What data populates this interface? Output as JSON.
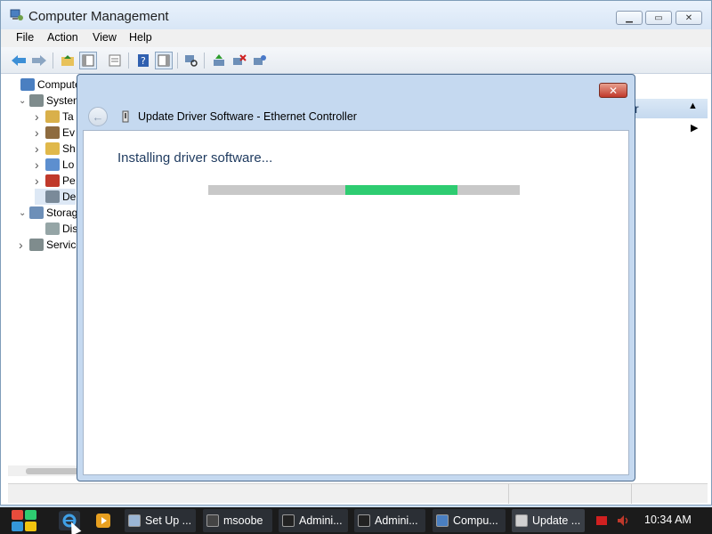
{
  "window": {
    "title": "Computer Management",
    "icon": "computer-management-icon"
  },
  "menu": [
    "File",
    "Action",
    "View",
    "Help"
  ],
  "tree": {
    "items": [
      {
        "label": "Computer",
        "indent": 0,
        "expander": "",
        "icon": "computer-icon"
      },
      {
        "label": "System",
        "indent": 1,
        "expander": "expanded",
        "icon": "tools-icon"
      },
      {
        "label": "Ta",
        "indent": 2,
        "expander": "collapsed",
        "icon": "clock-icon"
      },
      {
        "label": "Ev",
        "indent": 2,
        "expander": "collapsed",
        "icon": "event-viewer-icon"
      },
      {
        "label": "Sh",
        "indent": 2,
        "expander": "collapsed",
        "icon": "shared-folder-icon"
      },
      {
        "label": "Lo",
        "indent": 2,
        "expander": "collapsed",
        "icon": "users-icon"
      },
      {
        "label": "Pe",
        "indent": 2,
        "expander": "collapsed",
        "icon": "performance-icon"
      },
      {
        "label": "De",
        "indent": 2,
        "expander": "",
        "icon": "device-manager-icon"
      },
      {
        "label": "Storag",
        "indent": 1,
        "expander": "expanded",
        "icon": "storage-icon"
      },
      {
        "label": "Dis",
        "indent": 2,
        "expander": "",
        "icon": "disk-icon"
      },
      {
        "label": "Service",
        "indent": 1,
        "expander": "collapsed",
        "icon": "services-icon"
      }
    ]
  },
  "actions_pane": {
    "header_text": "r"
  },
  "dialog": {
    "title": "Update Driver Software - Ethernet Controller",
    "status_text": "Installing driver software...",
    "progress": {
      "start_fraction": 0.44,
      "end_fraction": 0.8
    },
    "accent": "#2ecc71"
  },
  "taskbar": {
    "tasks": [
      {
        "label": "Set Up ...",
        "icon": "setup-icon"
      },
      {
        "label": "msoobe",
        "icon": "msoobe-icon"
      },
      {
        "label": "Admini...",
        "icon": "cmd-icon"
      },
      {
        "label": "Admini...",
        "icon": "cmd-icon"
      },
      {
        "label": "Compu...",
        "icon": "computer-management-icon"
      },
      {
        "label": "Update ...",
        "icon": "update-driver-icon"
      }
    ],
    "clock": "10:34 AM"
  }
}
